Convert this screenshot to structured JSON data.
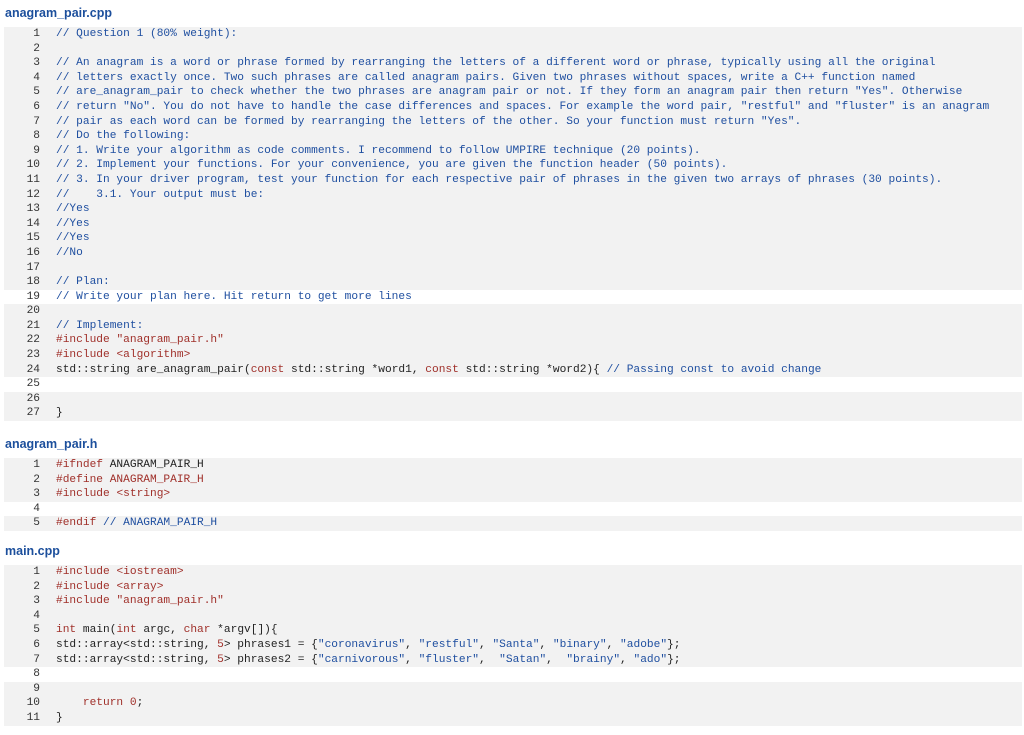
{
  "files": [
    {
      "name": "anagram_pair.cpp",
      "lines": [
        {
          "n": "1",
          "tokens": [
            {
              "t": "// Question 1 (80% weight):",
              "c": "c"
            }
          ]
        },
        {
          "n": "2",
          "tokens": []
        },
        {
          "n": "3",
          "tokens": [
            {
              "t": "// An anagram is a word or phrase formed by rearranging the letters of a different word or phrase, typically using all the original",
              "c": "c"
            }
          ]
        },
        {
          "n": "4",
          "tokens": [
            {
              "t": "// letters exactly once. Two such phrases are called anagram pairs. Given two phrases without spaces, write a C++ function named",
              "c": "c"
            }
          ]
        },
        {
          "n": "5",
          "tokens": [
            {
              "t": "// are_anagram_pair to check whether the two phrases are anagram pair or not. If they form an anagram pair then return \"Yes\". Otherwise",
              "c": "c"
            }
          ]
        },
        {
          "n": "6",
          "tokens": [
            {
              "t": "// return \"No\". You do not have to handle the case differences and spaces. For example the word pair, \"restful\" and \"fluster\" is an anagram",
              "c": "c"
            }
          ]
        },
        {
          "n": "7",
          "tokens": [
            {
              "t": "// pair as each word can be formed by rearranging the letters of the other. So your function must return \"Yes\".",
              "c": "c"
            }
          ]
        },
        {
          "n": "8",
          "tokens": [
            {
              "t": "// Do the following:",
              "c": "c"
            }
          ]
        },
        {
          "n": "9",
          "tokens": [
            {
              "t": "// 1. Write your algorithm as code comments. I recommend to follow UMPIRE technique (20 points).",
              "c": "c"
            }
          ]
        },
        {
          "n": "10",
          "tokens": [
            {
              "t": "// 2. Implement your functions. For your convenience, you are given the function header (50 points).",
              "c": "c"
            }
          ]
        },
        {
          "n": "11",
          "tokens": [
            {
              "t": "// 3. In your driver program, test your function for each respective pair of phrases in the given two arrays of phrases (30 points).",
              "c": "c"
            }
          ]
        },
        {
          "n": "12",
          "tokens": [
            {
              "t": "//    3.1. Your output must be:",
              "c": "c"
            }
          ]
        },
        {
          "n": "13",
          "tokens": [
            {
              "t": "//Yes",
              "c": "c"
            }
          ]
        },
        {
          "n": "14",
          "tokens": [
            {
              "t": "//Yes",
              "c": "c"
            }
          ]
        },
        {
          "n": "15",
          "tokens": [
            {
              "t": "//Yes",
              "c": "c"
            }
          ]
        },
        {
          "n": "16",
          "tokens": [
            {
              "t": "//No",
              "c": "c"
            }
          ]
        },
        {
          "n": "17",
          "tokens": []
        },
        {
          "n": "18",
          "tokens": [
            {
              "t": "// Plan:",
              "c": "c"
            }
          ]
        },
        {
          "n": "19",
          "hl": true,
          "tokens": [
            {
              "t": "// Write your plan here. Hit return to get more lines",
              "c": "c"
            }
          ]
        },
        {
          "n": "20",
          "tokens": []
        },
        {
          "n": "21",
          "tokens": [
            {
              "t": "// Implement:",
              "c": "c"
            }
          ]
        },
        {
          "n": "22",
          "tokens": [
            {
              "t": "#include ",
              "c": "k"
            },
            {
              "t": "\"anagram_pair.h\"",
              "c": "k"
            }
          ]
        },
        {
          "n": "23",
          "tokens": [
            {
              "t": "#include ",
              "c": "k"
            },
            {
              "t": "<algorithm>",
              "c": "k"
            }
          ]
        },
        {
          "n": "24",
          "tokens": [
            {
              "t": "std::string are_anagram_pair(",
              "c": "t"
            },
            {
              "t": "const",
              "c": "k"
            },
            {
              "t": " std::string *word1, ",
              "c": "t"
            },
            {
              "t": "const",
              "c": "k"
            },
            {
              "t": " std::string *word2){ ",
              "c": "t"
            },
            {
              "t": "// Passing const to avoid change",
              "c": "c"
            }
          ]
        },
        {
          "n": "25",
          "hl": true,
          "tokens": []
        },
        {
          "n": "26",
          "tokens": []
        },
        {
          "n": "27",
          "tokens": [
            {
              "t": "}",
              "c": "t"
            }
          ]
        }
      ]
    },
    {
      "name": "anagram_pair.h",
      "lines": [
        {
          "n": "1",
          "tokens": [
            {
              "t": "#ifndef ",
              "c": "k"
            },
            {
              "t": "ANAGRAM_PAIR_H",
              "c": "t"
            }
          ]
        },
        {
          "n": "2",
          "tokens": [
            {
              "t": "#define ANAGRAM_PAIR_H",
              "c": "k"
            }
          ]
        },
        {
          "n": "3",
          "tokens": [
            {
              "t": "#include ",
              "c": "k"
            },
            {
              "t": "<string>",
              "c": "k"
            }
          ]
        },
        {
          "n": "4",
          "hl": true,
          "tokens": []
        },
        {
          "n": "5",
          "tokens": [
            {
              "t": "#endif ",
              "c": "k"
            },
            {
              "t": "// ANAGRAM_PAIR_H",
              "c": "c"
            }
          ]
        }
      ]
    },
    {
      "name": "main.cpp",
      "lines": [
        {
          "n": "1",
          "tokens": [
            {
              "t": "#include ",
              "c": "k"
            },
            {
              "t": "<iostream>",
              "c": "k"
            }
          ]
        },
        {
          "n": "2",
          "tokens": [
            {
              "t": "#include ",
              "c": "k"
            },
            {
              "t": "<array>",
              "c": "k"
            }
          ]
        },
        {
          "n": "3",
          "tokens": [
            {
              "t": "#include ",
              "c": "k"
            },
            {
              "t": "\"anagram_pair.h\"",
              "c": "k"
            }
          ]
        },
        {
          "n": "4",
          "tokens": []
        },
        {
          "n": "5",
          "tokens": [
            {
              "t": "int",
              "c": "k"
            },
            {
              "t": " main(",
              "c": "t"
            },
            {
              "t": "int",
              "c": "k"
            },
            {
              "t": " argc, ",
              "c": "t"
            },
            {
              "t": "char",
              "c": "k"
            },
            {
              "t": " *argv[]){",
              "c": "t"
            }
          ]
        },
        {
          "n": "6",
          "tokens": [
            {
              "t": "std::array<std::string, ",
              "c": "t"
            },
            {
              "t": "5",
              "c": "k"
            },
            {
              "t": "> phrases1 = {",
              "c": "t"
            },
            {
              "t": "\"coronavirus\"",
              "c": "s"
            },
            {
              "t": ", ",
              "c": "t"
            },
            {
              "t": "\"restful\"",
              "c": "s"
            },
            {
              "t": ", ",
              "c": "t"
            },
            {
              "t": "\"Santa\"",
              "c": "s"
            },
            {
              "t": ", ",
              "c": "t"
            },
            {
              "t": "\"binary\"",
              "c": "s"
            },
            {
              "t": ", ",
              "c": "t"
            },
            {
              "t": "\"adobe\"",
              "c": "s"
            },
            {
              "t": "};",
              "c": "t"
            }
          ]
        },
        {
          "n": "7",
          "tokens": [
            {
              "t": "std::array<std::string, ",
              "c": "t"
            },
            {
              "t": "5",
              "c": "k"
            },
            {
              "t": "> phrases2 = {",
              "c": "t"
            },
            {
              "t": "\"carnivorous\"",
              "c": "s"
            },
            {
              "t": ", ",
              "c": "t"
            },
            {
              "t": "\"fluster\"",
              "c": "s"
            },
            {
              "t": ",  ",
              "c": "t"
            },
            {
              "t": "\"Satan\"",
              "c": "s"
            },
            {
              "t": ",  ",
              "c": "t"
            },
            {
              "t": "\"brainy\"",
              "c": "s"
            },
            {
              "t": ", ",
              "c": "t"
            },
            {
              "t": "\"ado\"",
              "c": "s"
            },
            {
              "t": "};",
              "c": "t"
            }
          ]
        },
        {
          "n": "8",
          "hl": true,
          "tokens": []
        },
        {
          "n": "9",
          "tokens": []
        },
        {
          "n": "10",
          "tokens": [
            {
              "t": "    return ",
              "c": "k"
            },
            {
              "t": "0",
              "c": "k"
            },
            {
              "t": ";",
              "c": "t"
            }
          ]
        },
        {
          "n": "11",
          "tokens": [
            {
              "t": "}",
              "c": "t"
            }
          ]
        }
      ]
    }
  ]
}
